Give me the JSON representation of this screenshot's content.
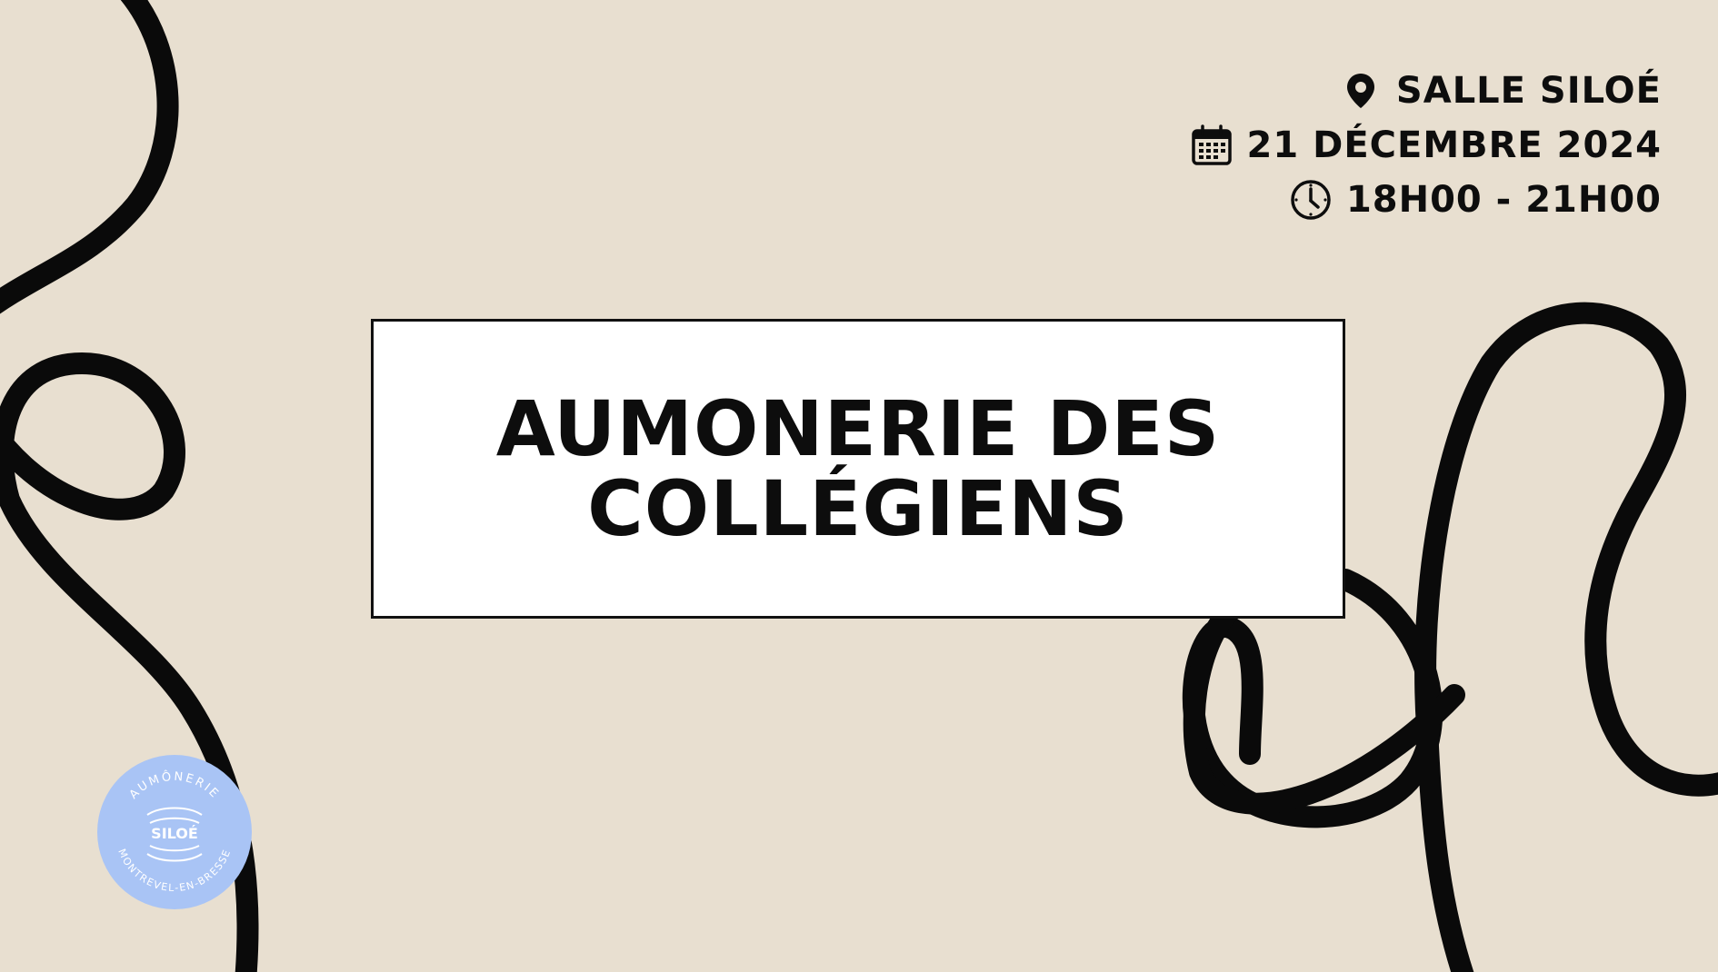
{
  "event": {
    "location": "SALLE SILOÉ",
    "date": "21 DÉCEMBRE 2024",
    "time": "18H00 - 21H00"
  },
  "title": {
    "line1": "AUMONERIE DES",
    "line2": "COLLÉGIENS"
  },
  "logo": {
    "top_text": "AUMÔNERIE",
    "center_text": "SILOÉ",
    "bottom_text": "MONTREVEL-EN-BRESSE"
  },
  "colors": {
    "background": "#e8dfd0",
    "ink": "#0d0d0d",
    "box": "#ffffff",
    "logo": "#a9c4f5"
  },
  "icons": {
    "location": "map-pin-icon",
    "date": "calendar-icon",
    "time": "clock-icon"
  }
}
